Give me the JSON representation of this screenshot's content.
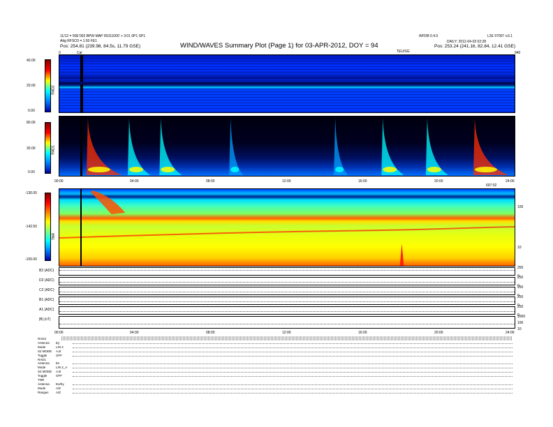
{
  "header": {
    "left_line1": "11/12 = 50E’003 BPW·MAP 00311000’ + 3:01 0P1 SP1",
    "left_line2": "Attg RFSO3 = 1:50 FE1",
    "left_pos": "Pos: 254.81 (239.98, 84.5s, 11.79 GSE)",
    "title": "WIND/WAVES Summary Plot (Page 1) for 03-APR-2012, DOY = 94",
    "right_id": "WFDB 0.4.0",
    "right_top": "L2E 97007 v.6.1",
    "right_date": "DAILY: 2012-04-03 02:28",
    "right_pos": "Pos: 253.24 (241.16, 82.84, 12.41 GSE)",
    "marker_left": "Cal",
    "marker_right": "TEU/SG",
    "corner_left": "0",
    "corner_right": "940"
  },
  "panels": {
    "rad2": {
      "label": "RAD2",
      "ticks": [
        "40.00",
        "20.00",
        "0.00"
      ]
    },
    "rad1": {
      "label": "RAD1",
      "ticks": [
        "80.00",
        "30.00",
        "0.00"
      ]
    },
    "tnr": {
      "label": "TNR",
      "ticks": [
        "-130.00",
        "-142.50",
        "-155.00"
      ],
      "right_ticks": [
        "100",
        "10"
      ],
      "corner_label": "697:02"
    }
  },
  "time_axis": {
    "labels": [
      "00:00",
      "04:00",
      "08:00",
      "12:00",
      "16:00",
      "20:00",
      "24:00"
    ]
  },
  "line_panels": [
    {
      "label": "B2 (ADC)",
      "right_ticks": [
        "250",
        "0"
      ]
    },
    {
      "label": "D2 (ADC)",
      "right_ticks": [
        "250",
        "0"
      ]
    },
    {
      "label": "C2 (ADC)",
      "right_ticks": [
        "250",
        "0"
      ]
    },
    {
      "label": "B1 (ADC)",
      "right_ticks": [
        "250",
        "0"
      ]
    },
    {
      "label": "A1 (ADC)",
      "right_ticks": [
        "250",
        "0"
      ]
    },
    {
      "label": "|B| (nT)",
      "right_ticks": [
        "1000",
        "100",
        "10"
      ]
    }
  ],
  "status_table": [
    {
      "name": "RAD2",
      "value": ""
    },
    {
      "name": "Antenna",
      "value": "Ey"
    },
    {
      "name": "Mode",
      "value": "LIN 2"
    },
    {
      "name": "S2 MODE",
      "value": "A,B"
    },
    {
      "name": "Toggle",
      "value": "OFF"
    },
    {
      "name": "RAD1",
      "value": ""
    },
    {
      "name": "Antenna",
      "value": "Ex"
    },
    {
      "name": "Mode",
      "value": "LIN 2_A"
    },
    {
      "name": "S2 MODE",
      "value": "A,B"
    },
    {
      "name": "Toggle",
      "value": "OFF"
    },
    {
      "name": "TNR",
      "value": ""
    },
    {
      "name": "Antenna",
      "value": "Ex/Ey"
    },
    {
      "name": "Mode",
      "value": "A/Z"
    },
    {
      "name": "Ranges",
      "value": "A/Z"
    }
  ],
  "chart_data": [
    {
      "type": "heatmap",
      "title": "WIND/WAVES Summary Plot (Page 1) for 03-APR-2012, DOY = 94",
      "name": "RAD2",
      "xlabel": "",
      "ylabel": "RAD2",
      "xlim": [
        "00:00",
        "24:00"
      ],
      "colorbar_range": [
        0,
        40
      ],
      "colorbar_ticks": [
        40,
        20,
        0
      ],
      "background_level": "low (blue)",
      "features": [
        {
          "type": "vertical_band",
          "time": "01:20",
          "level": "dark"
        },
        {
          "type": "horizontal_band",
          "level": "dark",
          "position": "upper-mid"
        }
      ]
    },
    {
      "type": "heatmap",
      "name": "RAD1",
      "xlabel": "",
      "ylabel": "RAD1",
      "xlim": [
        "00:00",
        "24:00"
      ],
      "colorbar_range": [
        0,
        80
      ],
      "colorbar_ticks": [
        80,
        30,
        0
      ],
      "bursts": [
        {
          "time": "01:30",
          "intensity": "high"
        },
        {
          "time": "03:40",
          "intensity": "medium"
        },
        {
          "time": "05:20",
          "intensity": "medium"
        },
        {
          "time": "09:00",
          "intensity": "low"
        },
        {
          "time": "14:30",
          "intensity": "low"
        },
        {
          "time": "17:00",
          "intensity": "medium"
        },
        {
          "time": "19:20",
          "intensity": "medium"
        },
        {
          "time": "21:50",
          "intensity": "high"
        }
      ]
    },
    {
      "type": "heatmap",
      "name": "TNR",
      "xlabel": "",
      "ylabel": "TNR",
      "xlim": [
        "00:00",
        "24:00"
      ],
      "colorbar_range": [
        -155,
        -130
      ],
      "colorbar_ticks": [
        -130,
        -142.5,
        -155
      ],
      "right_axis_ticks": [
        100,
        10
      ],
      "features": [
        {
          "type": "burst",
          "time": "02:00",
          "intensity": "high"
        },
        {
          "type": "plasma_line",
          "description": "horizontal emission line near 40% height"
        },
        {
          "type": "spike",
          "time": "18:00",
          "intensity": "high"
        }
      ]
    },
    {
      "type": "line",
      "name": "Housekeeping",
      "series": [
        {
          "name": "B2 (ADC)",
          "ylim": [
            0,
            250
          ]
        },
        {
          "name": "D2 (ADC)",
          "ylim": [
            0,
            250
          ]
        },
        {
          "name": "C2 (ADC)",
          "ylim": [
            0,
            250
          ]
        },
        {
          "name": "B1 (ADC)",
          "ylim": [
            0,
            250
          ]
        },
        {
          "name": "A1 (ADC)",
          "ylim": [
            0,
            250
          ]
        },
        {
          "name": "|B| (nT)",
          "ylim": [
            10,
            1000
          ],
          "scale": "log"
        }
      ],
      "xlim": [
        "00:00",
        "24:00"
      ]
    }
  ],
  "colors": {
    "spectrum": [
      "#000080",
      "#0000ff",
      "#00a0ff",
      "#00ffff",
      "#80ff80",
      "#ffff00",
      "#ff8000",
      "#ff0000",
      "#800000"
    ]
  }
}
